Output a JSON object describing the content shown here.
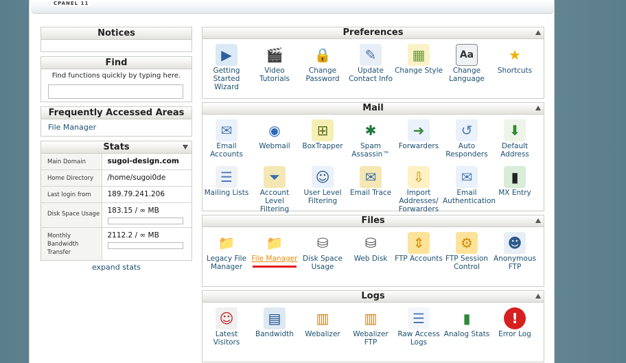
{
  "brand": "CPANEL 11",
  "left": {
    "notices": {
      "title": "Notices"
    },
    "find": {
      "title": "Find",
      "hint": "Find functions quickly by typing here.",
      "value": ""
    },
    "faa": {
      "title": "Frequently Accessed Areas",
      "links": [
        "File Manager"
      ]
    },
    "stats": {
      "title": "Stats",
      "rows": [
        {
          "label": "Main Domain",
          "value": "sugoi-design.com"
        },
        {
          "label": "Home Directory",
          "value": "/home/sugoi0de"
        },
        {
          "label": "Last login from",
          "value": "189.79.241.206"
        },
        {
          "label": "Disk Space Usage",
          "value": "183.15 / ∞ MB",
          "usage_fraction": 0
        },
        {
          "label": "Monthly Bandwidth Transfer",
          "value": "2112.2 / ∞ MB",
          "usage_fraction": 0
        }
      ],
      "expand_label": "expand stats"
    }
  },
  "sections": [
    {
      "title": "Preferences",
      "items": [
        {
          "label": "Getting Started Wizard",
          "icon": "play-icon"
        },
        {
          "label": "Video Tutorials",
          "icon": "clapperboard-icon"
        },
        {
          "label": "Change Password",
          "icon": "lock-password-icon"
        },
        {
          "label": "Update Contact Info",
          "icon": "contact-card-icon"
        },
        {
          "label": "Change Style",
          "icon": "style-icon"
        },
        {
          "label": "Change Language",
          "icon": "language-icon"
        },
        {
          "label": "Shortcuts",
          "icon": "star-icon"
        }
      ]
    },
    {
      "title": "Mail",
      "items": [
        {
          "label": "Email Accounts",
          "icon": "envelope-icon"
        },
        {
          "label": "Webmail",
          "icon": "globe-mail-icon"
        },
        {
          "label": "BoxTrapper",
          "icon": "trap-icon"
        },
        {
          "label": "Spam Assassin™",
          "icon": "spamassassin-icon"
        },
        {
          "label": "Forwarders",
          "icon": "forward-mail-icon"
        },
        {
          "label": "Auto Responders",
          "icon": "autoresponder-icon"
        },
        {
          "label": "Default Address",
          "icon": "default-address-icon"
        },
        {
          "label": "Mailing Lists",
          "icon": "mailing-list-icon"
        },
        {
          "label": "Account Level Filtering",
          "icon": "funnel-icon"
        },
        {
          "label": "User Level Filtering",
          "icon": "user-filter-icon"
        },
        {
          "label": "Email Trace",
          "icon": "trace-icon"
        },
        {
          "label": "Import Addresses/ Forwarders",
          "icon": "import-icon"
        },
        {
          "label": "Email Authentication",
          "icon": "auth-mail-icon"
        },
        {
          "label": "MX Entry",
          "icon": "server-mail-icon"
        }
      ]
    },
    {
      "title": "Files",
      "items": [
        {
          "label": "Legacy File Manager",
          "icon": "folder-icon"
        },
        {
          "label": "File Manager",
          "icon": "folder-icon",
          "active": true
        },
        {
          "label": "Disk Space Usage",
          "icon": "disk-icon"
        },
        {
          "label": "Web Disk",
          "icon": "network-disk-icon"
        },
        {
          "label": "FTP Accounts",
          "icon": "ftp-icon"
        },
        {
          "label": "FTP Session Control",
          "icon": "ftp-session-icon"
        },
        {
          "label": "Anonymous FTP",
          "icon": "anonymous-ftp-icon"
        }
      ]
    },
    {
      "title": "Logs",
      "items": [
        {
          "label": "Latest Visitors",
          "icon": "visitors-icon"
        },
        {
          "label": "Bandwidth",
          "icon": "bandwidth-chart-icon"
        },
        {
          "label": "Webalizer",
          "icon": "bar-chart-icon"
        },
        {
          "label": "Webalizer FTP",
          "icon": "bar-chart-ftp-icon"
        },
        {
          "label": "Raw Access Logs",
          "icon": "document-icon"
        },
        {
          "label": "Analog Stats",
          "icon": "analog-chart-icon"
        },
        {
          "label": "Error Log",
          "icon": "error-icon"
        }
      ]
    }
  ]
}
